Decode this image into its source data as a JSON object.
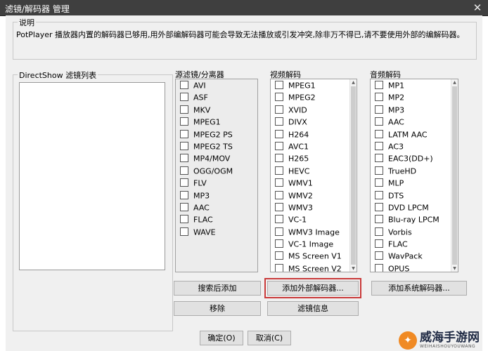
{
  "window": {
    "title": "滤镜/解码器 管理",
    "close_glyph": "✕"
  },
  "description": {
    "legend": "说明",
    "text": "PotPlayer 播放器内置的解码器已够用,用外部编解码器可能会导致无法播放或引发冲突,除非万不得已,请不要使用外部的编解码器。"
  },
  "directshow": {
    "label": "DirectShow 滤镜列表"
  },
  "source_filters": {
    "label": "源滤镜/分离器",
    "items": [
      "AVI",
      "ASF",
      "MKV",
      "MPEG1",
      "MPEG2 PS",
      "MPEG2 TS",
      "MP4/MOV",
      "OGG/OGM",
      "FLV",
      "MP3",
      "AAC",
      "FLAC",
      "WAVE"
    ]
  },
  "video_decoders": {
    "label": "视频解码",
    "items": [
      "MPEG1",
      "MPEG2",
      "XVID",
      "DIVX",
      "H264",
      "AVC1",
      "H265",
      "HEVC",
      "WMV1",
      "WMV2",
      "WMV3",
      "VC-1",
      "WMV3 Image",
      "VC-1 Image",
      "MS Screen V1",
      "MS Screen V2"
    ]
  },
  "audio_decoders": {
    "label": "音频解码",
    "items": [
      "MP1",
      "MP2",
      "MP3",
      "AAC",
      "LATM AAC",
      "AC3",
      "EAC3(DD+)",
      "TrueHD",
      "MLP",
      "DTS",
      "DVD LPCM",
      "Blu-ray LPCM",
      "Vorbis",
      "FLAC",
      "WavPack",
      "OPUS"
    ]
  },
  "buttons": {
    "search_add": "搜索后添加",
    "add_external": "添加外部解码器...",
    "add_system": "添加系统解码器...",
    "remove": "移除",
    "filter_info": "滤镜信息",
    "ok": "确定(O)",
    "cancel": "取消(C)"
  },
  "watermark": {
    "brand": "威海手游网",
    "sub": "WEIHAISHOUYOUWANG",
    "logo_glyph": "✦"
  },
  "colors": {
    "titlebar": "#3f3f3f",
    "highlight": "#c93a3a",
    "watermark_logo": "#f08a24"
  }
}
